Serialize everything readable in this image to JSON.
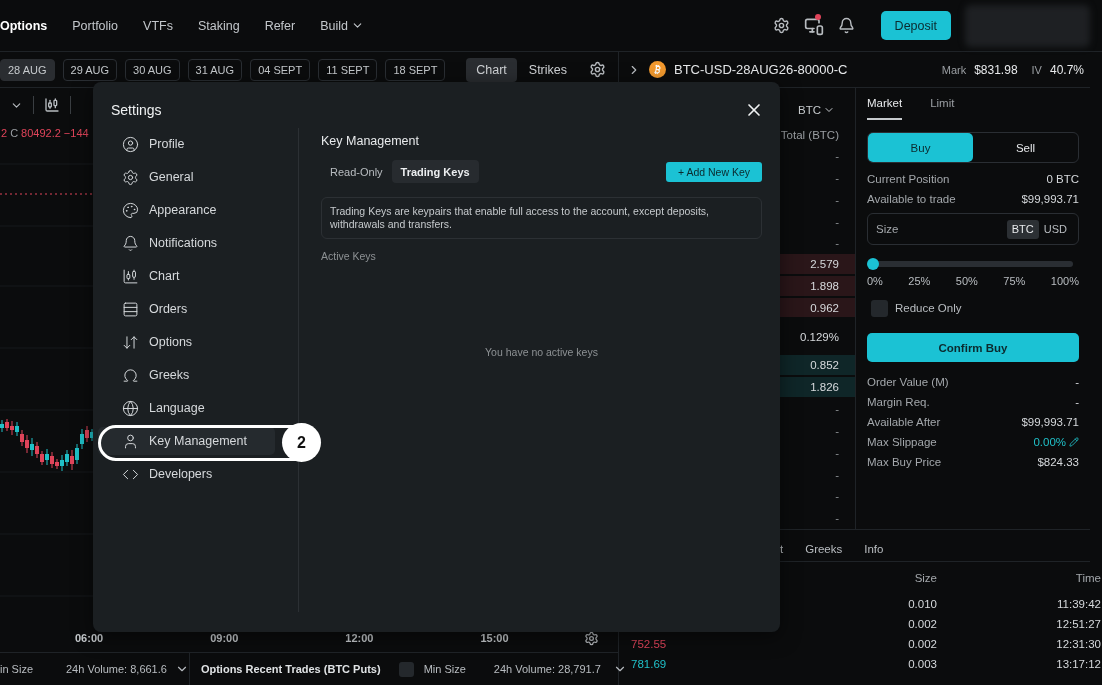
{
  "nav": {
    "items": [
      {
        "label": "Options",
        "selected": true,
        "dropdown": false
      },
      {
        "label": "Portfolio",
        "selected": false,
        "dropdown": false
      },
      {
        "label": "VTFs",
        "selected": false,
        "dropdown": false
      },
      {
        "label": "Staking",
        "selected": false,
        "dropdown": false
      },
      {
        "label": "Refer",
        "selected": false,
        "dropdown": false
      },
      {
        "label": "Build",
        "selected": false,
        "dropdown": true
      }
    ],
    "device_alert": true,
    "deposit": "Deposit"
  },
  "expiries": [
    {
      "label": "28 AUG",
      "selected": true
    },
    {
      "label": "29 AUG",
      "selected": false
    },
    {
      "label": "30 AUG",
      "selected": false
    },
    {
      "label": "31 AUG",
      "selected": false
    },
    {
      "label": "04 SEPT",
      "selected": false
    },
    {
      "label": "11 SEPT",
      "selected": false
    },
    {
      "label": "18 SEPT",
      "selected": false
    }
  ],
  "view_toggle": [
    {
      "label": "Chart",
      "selected": true
    },
    {
      "label": "Strikes",
      "selected": false
    }
  ],
  "chart": {
    "ohlc": [
      {
        "text": "2",
        "kind": "down"
      },
      {
        "text": "C",
        "kind": "label"
      },
      {
        "text": "80492.2",
        "kind": "down"
      },
      {
        "text": "−144",
        "kind": "down"
      }
    ],
    "time_axis": [
      "06:00",
      "09:00",
      "12:00",
      "15:00"
    ]
  },
  "left_footer": {
    "min_size": "in Size",
    "volume": "24h Volume: 8,661.6",
    "title": "Options Recent Trades (BTC Puts)",
    "checked": false,
    "min_size_2": "Min Size",
    "volume_2": "24h Volume: 28,791.7"
  },
  "instrument": {
    "symbol": "BTC-USD-28AUG26-80000-C",
    "mark_label": "Mark",
    "mark": "$831.98",
    "iv_label": "IV",
    "iv": "40.7%"
  },
  "order_book": {
    "unit": "BTC",
    "column": "Total (BTC)",
    "rows": [
      {
        "kind": "empty",
        "value": "-"
      },
      {
        "kind": "empty",
        "value": "-"
      },
      {
        "kind": "empty",
        "value": "-"
      },
      {
        "kind": "empty",
        "value": "-"
      },
      {
        "kind": "empty",
        "value": "-"
      },
      {
        "kind": "ask",
        "value": "2.579"
      },
      {
        "kind": "ask",
        "value": "1.898"
      },
      {
        "kind": "ask",
        "value": "0.962"
      },
      {
        "kind": "spread",
        "value": "0.129%"
      },
      {
        "kind": "bid",
        "value": "0.852"
      },
      {
        "kind": "bid",
        "value": "1.826"
      },
      {
        "kind": "empty",
        "value": "-"
      },
      {
        "kind": "empty",
        "value": "-"
      },
      {
        "kind": "empty",
        "value": "-"
      },
      {
        "kind": "empty",
        "value": "-"
      },
      {
        "kind": "empty",
        "value": "-"
      },
      {
        "kind": "empty",
        "value": "-"
      }
    ]
  },
  "order_form": {
    "order_types": [
      {
        "label": "Market",
        "selected": true
      },
      {
        "label": "Limit",
        "selected": false
      }
    ],
    "sides": [
      {
        "label": "Buy",
        "selected": true
      },
      {
        "label": "Sell",
        "selected": false
      }
    ],
    "position": [
      {
        "label": "Current Position",
        "value": "0 BTC"
      },
      {
        "label": "Available to trade",
        "value": "$99,993.71"
      }
    ],
    "size": {
      "placeholder": "Size",
      "units": [
        {
          "label": "BTC",
          "selected": true
        },
        {
          "label": "USD",
          "selected": false
        }
      ]
    },
    "slider": {
      "level": 0,
      "ticks": [
        "0%",
        "25%",
        "50%",
        "75%",
        "100%"
      ]
    },
    "reduce_only": {
      "label": "Reduce Only",
      "checked": false
    },
    "submit": "Confirm Buy",
    "summary": [
      {
        "label": "Order Value (M)",
        "value": "-",
        "kind": "plain"
      },
      {
        "label": "Margin Req.",
        "value": "-",
        "kind": "plain"
      },
      {
        "label": "Available After",
        "value": "$99,993.71",
        "kind": "plain"
      },
      {
        "label": "Max Slippage",
        "value": "0.00%",
        "kind": "editable"
      },
      {
        "label": "Max Buy Price",
        "value": "$824.33",
        "kind": "plain"
      }
    ]
  },
  "trades": {
    "tabs": [
      {
        "label": "t"
      },
      {
        "label": "Greeks"
      },
      {
        "label": "Info"
      }
    ],
    "columns": [
      "Size",
      "Time"
    ],
    "rows": [
      {
        "size": "0.010",
        "time": "11:39:42"
      },
      {
        "size": "0.002",
        "time": "12:51:27"
      },
      {
        "price": "752.55",
        "kind": "sell",
        "size": "0.002",
        "time": "12:31:30"
      },
      {
        "price": "781.69",
        "kind": "buy",
        "size": "0.003",
        "time": "13:17:12"
      }
    ]
  },
  "settings": {
    "title": "Settings",
    "menu": [
      {
        "label": "Profile",
        "selected": false
      },
      {
        "label": "General",
        "selected": false
      },
      {
        "label": "Appearance",
        "selected": false
      },
      {
        "label": "Notifications",
        "selected": false
      },
      {
        "label": "Chart",
        "selected": false
      },
      {
        "label": "Orders",
        "selected": false
      },
      {
        "label": "Options",
        "selected": false
      },
      {
        "label": "Greeks",
        "selected": false
      },
      {
        "label": "Language",
        "selected": false
      },
      {
        "label": "Key Management",
        "selected": true
      },
      {
        "label": "Developers",
        "selected": false
      }
    ],
    "section": {
      "title": "Key Management",
      "tabs": [
        {
          "label": "Read-Only",
          "selected": false
        },
        {
          "label": "Trading Keys",
          "selected": true
        }
      ],
      "add_button": "+ Add New Key",
      "info": "Trading Keys are keypairs that enable full access to the account, except deposits, withdrawals and transfers.",
      "list_title": "Active Keys",
      "empty": "You have no active keys"
    }
  },
  "callout": {
    "label": "2"
  }
}
